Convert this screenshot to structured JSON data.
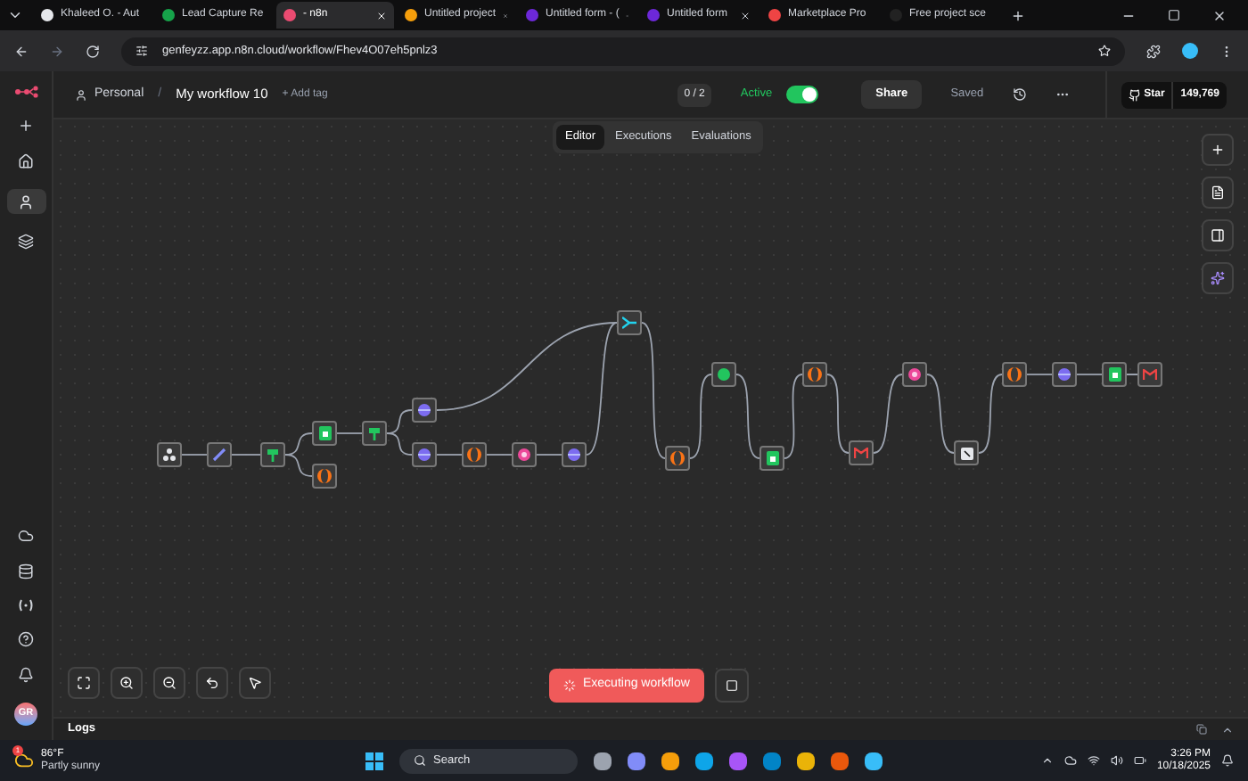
{
  "browser": {
    "tabs": [
      {
        "title": "Khaleed O. - Aut",
        "selected": false
      },
      {
        "title": "Lead Capture Re",
        "selected": false
      },
      {
        "title": "- n8n",
        "selected": true
      },
      {
        "title": "Untitled project",
        "selected": false
      },
      {
        "title": "Untitled form - (",
        "selected": false
      },
      {
        "title": "Untitled form",
        "selected": false
      },
      {
        "title": "Marketplace Pro",
        "selected": false
      },
      {
        "title": "Free project sce",
        "selected": false
      }
    ],
    "url": "genfeyzz.app.n8n.cloud/workflow/Fhev4O07eh5pnlz3"
  },
  "header": {
    "project": "Personal",
    "separator": "/",
    "workflow": "My workflow 10",
    "add_tag": "+ Add tag",
    "counter": "0 / 2",
    "active_label": "Active",
    "active": true,
    "share": "Share",
    "saved": "Saved",
    "star": "Star",
    "star_count": "149,769"
  },
  "view_tabs": [
    {
      "label": "Editor",
      "selected": true
    },
    {
      "label": "Executions",
      "selected": false
    },
    {
      "label": "Evaluations",
      "selected": false
    }
  ],
  "sidebar": {
    "avatar": "GR"
  },
  "nodes": [
    {
      "kind": "webhook"
    },
    {
      "kind": "edit"
    },
    {
      "kind": "if"
    },
    {
      "kind": "sheets"
    },
    {
      "kind": "code"
    },
    {
      "kind": "if"
    },
    {
      "kind": "http"
    },
    {
      "kind": "http"
    },
    {
      "kind": "code"
    },
    {
      "kind": "wait"
    },
    {
      "kind": "http"
    },
    {
      "kind": "merge"
    },
    {
      "kind": "code"
    },
    {
      "kind": "row"
    },
    {
      "kind": "sheets"
    },
    {
      "kind": "code"
    },
    {
      "kind": "gmail"
    },
    {
      "kind": "wait"
    },
    {
      "kind": "page"
    },
    {
      "kind": "code"
    },
    {
      "kind": "http"
    },
    {
      "kind": "sheets"
    },
    {
      "kind": "gmail"
    }
  ],
  "execute_button": "Executing workflow",
  "logs": {
    "title": "Logs"
  },
  "taskbar": {
    "temperature": "86°F",
    "weather": "Partly sunny",
    "weather_badge": "1",
    "search": "Search",
    "time": "3:26 PM",
    "date": "10/18/2025"
  }
}
